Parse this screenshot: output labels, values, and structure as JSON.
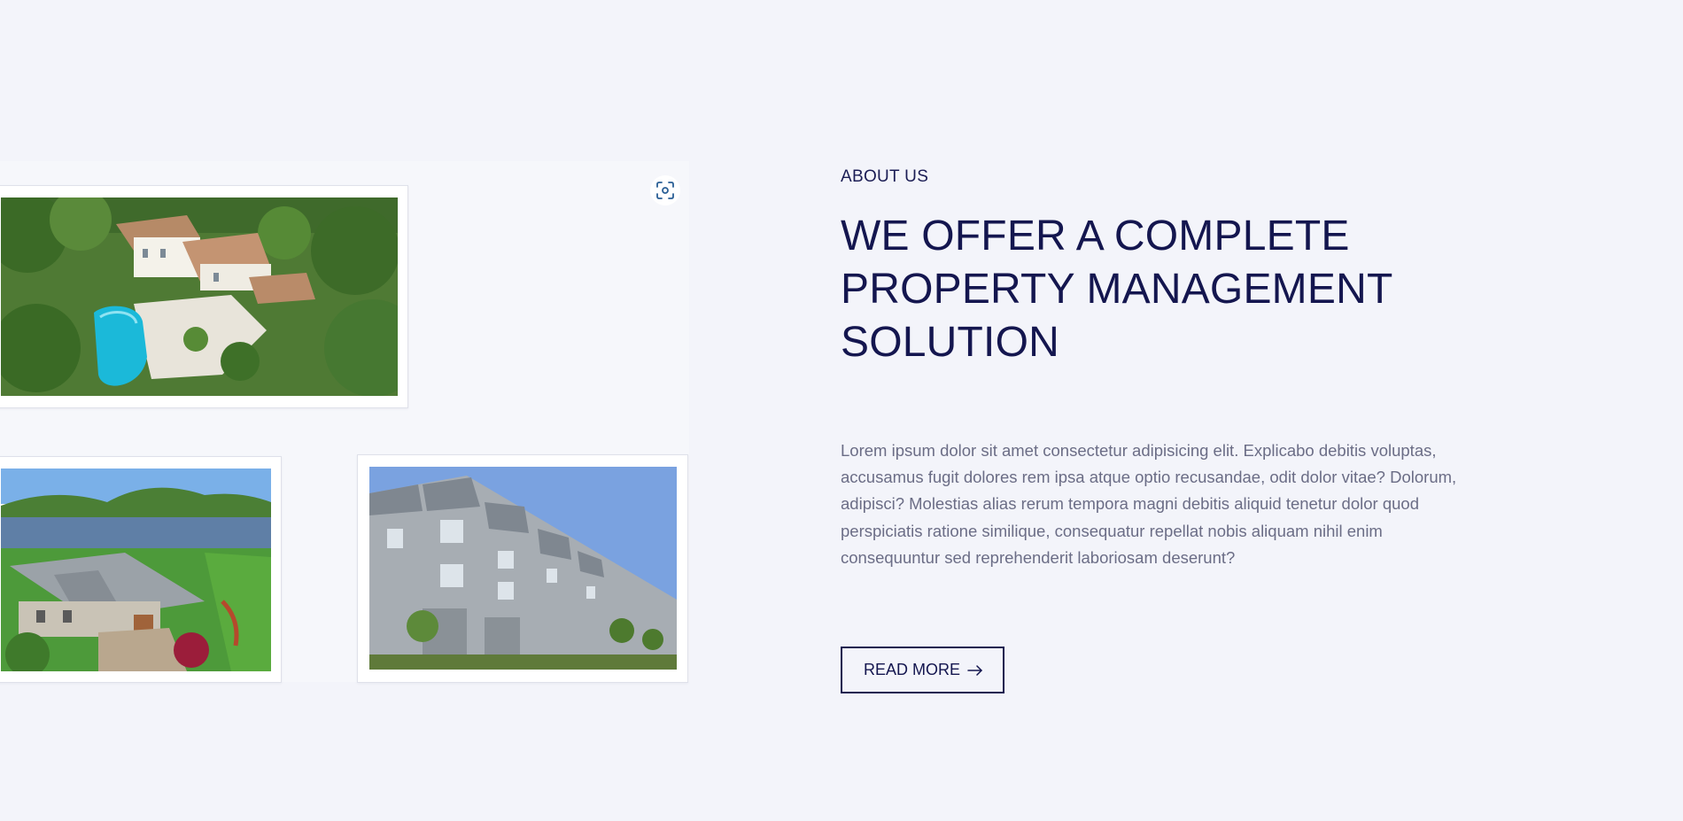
{
  "gallery": {
    "images": [
      {
        "icon": "villa-with-pool-photo"
      },
      {
        "icon": "lakeside-estate-photo"
      },
      {
        "icon": "townhouse-row-photo"
      }
    ],
    "zoom_icon": "zoom-focus-icon"
  },
  "about": {
    "eyebrow": "ABOUT US",
    "headline_lines": [
      "WE OFFER A COMPLETE",
      "PROPERTY MANAGEMENT",
      "SOLUTION"
    ],
    "body": "Lorem ipsum dolor sit amet consectetur adipisicing elit. Explicabo debitis voluptas, accusamus fugit dolores rem ipsa atque optio recusandae, odit dolor vitae? Dolorum, adipisci? Molestias alias rerum tempora magni debitis aliquid tenetur dolor quod perspiciatis ratione similique, consequatur repellat nobis aliquam nihil enim consequuntur sed reprehenderit laboriosam deserunt?",
    "button_label": "READ MORE",
    "button_icon": "arrow-right-icon"
  },
  "colors": {
    "background": "#f3f4fa",
    "heading": "#14164f",
    "body_text": "#6b6d86",
    "zoom_icon": "#2a5f96"
  }
}
